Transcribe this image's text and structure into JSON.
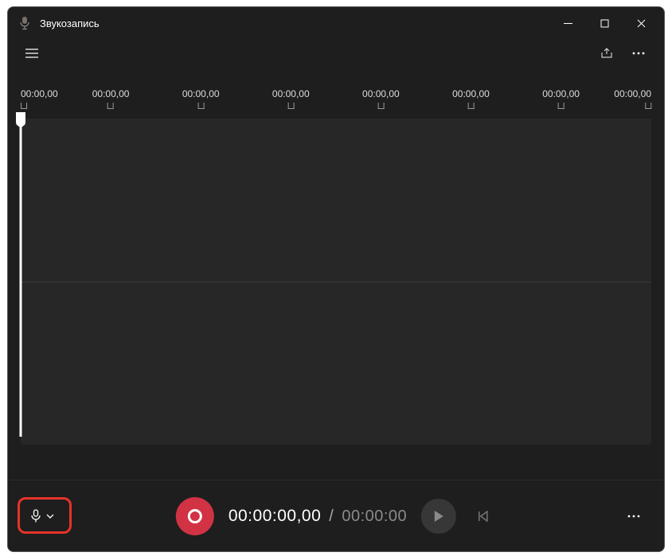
{
  "app": {
    "title": "Звукозапись"
  },
  "timeline": {
    "ticks": [
      "00:00,00",
      "00:00,00",
      "00:00,00",
      "00:00,00",
      "00:00,00",
      "00:00,00",
      "00:00,00",
      "00:00,00"
    ]
  },
  "playback": {
    "current": "00:00:00,00",
    "separator": "/",
    "total": "00:00:00"
  },
  "colors": {
    "record": "#d13344",
    "highlight": "#e5332a",
    "background": "#1e1e1e",
    "waveform_bg": "#272727"
  }
}
